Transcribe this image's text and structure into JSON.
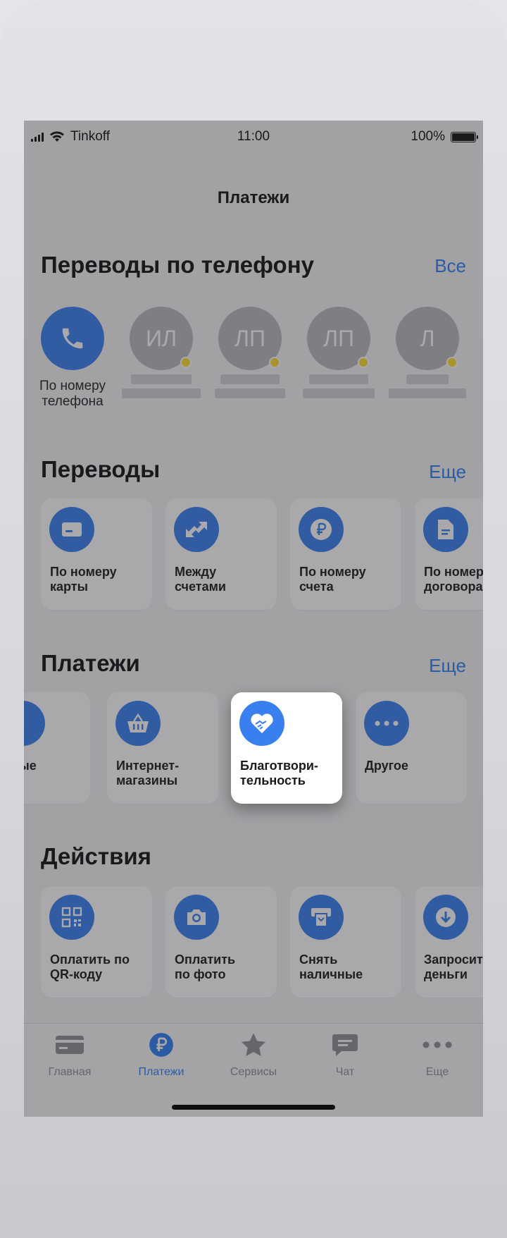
{
  "status": {
    "carrier": "Tinkoff",
    "time": "11:00",
    "battery": "100%"
  },
  "nav": {
    "title": "Платежи"
  },
  "phone_transfers": {
    "title": "Переводы по телефону",
    "link": "Все",
    "by_number_label": "По номеру телефона",
    "contacts": [
      {
        "initials": "ИЛ"
      },
      {
        "initials": "ЛП"
      },
      {
        "initials": "ЛП"
      },
      {
        "initials": "Л"
      }
    ]
  },
  "transfers": {
    "title": "Переводы",
    "link": "Еще",
    "items": [
      {
        "label": "По номеру\nкарты",
        "icon": "card-icon"
      },
      {
        "label": "Между\nсчетами",
        "icon": "arrows-exchange-icon"
      },
      {
        "label": "По номеру\nсчета",
        "icon": "ruble-icon"
      },
      {
        "label": "По номеру\nдоговора",
        "icon": "document-icon"
      }
    ]
  },
  "payments": {
    "title": "Платежи",
    "link": "Еще",
    "items": [
      {
        "label": "альные",
        "icon": "utilities-icon"
      },
      {
        "label": "Интернет-\nмагазины",
        "icon": "basket-icon"
      },
      {
        "label": "Благотвори-\nтельность",
        "icon": "heart-hand-icon"
      },
      {
        "label": "Другое",
        "icon": "more-dots-icon"
      }
    ]
  },
  "actions": {
    "title": "Действия",
    "items": [
      {
        "label": "Оплатить по\nQR-коду",
        "icon": "qr-code-icon"
      },
      {
        "label": "Оплатить\nпо фото",
        "icon": "camera-icon"
      },
      {
        "label": "Снять\nналичные",
        "icon": "atm-icon"
      },
      {
        "label": "Запросить\nденьги",
        "icon": "download-circle-icon"
      }
    ]
  },
  "tabbar": {
    "active": "Платежи",
    "items": [
      {
        "label": "Главная",
        "icon": "card-tab-icon"
      },
      {
        "label": "Платежи",
        "icon": "ruble-tab-icon"
      },
      {
        "label": "Сервисы",
        "icon": "star-icon"
      },
      {
        "label": "Чат",
        "icon": "chat-icon"
      },
      {
        "label": "Еще",
        "icon": "more-icon"
      }
    ]
  },
  "colors": {
    "accent": "#2f7ef6",
    "icon_bg": "#3a7ff0",
    "presence_dot": "#ffdb2e"
  }
}
